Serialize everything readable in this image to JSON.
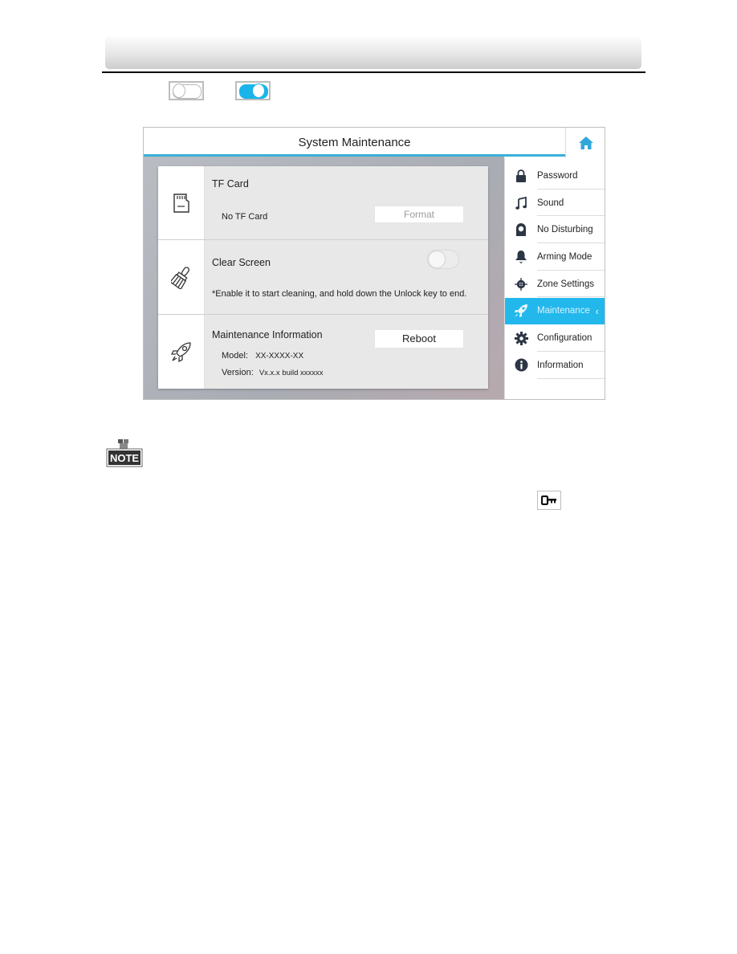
{
  "document": {
    "legend_toggles": [
      {
        "state": "off",
        "icon": "toggle-off-icon"
      },
      {
        "state": "on",
        "icon": "toggle-on-icon"
      }
    ],
    "note_label": "NOTE",
    "key_icon": "key-icon"
  },
  "device": {
    "title": "System Maintenance",
    "home_icon": "home-icon",
    "colors": {
      "accent": "#22b8ec",
      "title_underline": "#3ab0d8"
    },
    "rows": [
      {
        "icon": "tf-card-icon",
        "title": "TF Card",
        "status": "No TF Card",
        "button_label": "Format",
        "button_enabled": false
      },
      {
        "icon": "brush-icon",
        "title": "Clear Screen",
        "toggle_state": "off",
        "hint": "*Enable it to start cleaning, and hold down the Unlock key to end."
      },
      {
        "icon": "rocket-icon",
        "title": "Maintenance Information",
        "button_label": "Reboot",
        "model_label": "Model:",
        "model_value": "XX-XXXX-XX",
        "version_label": "Version:",
        "version_value": "Vx.x.x build xxxxxx"
      }
    ],
    "sidebar": {
      "items": [
        {
          "label": "Password",
          "icon": "lock-icon",
          "active": false
        },
        {
          "label": "Sound",
          "icon": "music-note-icon",
          "active": false
        },
        {
          "label": "No Disturbing",
          "icon": "no-disturb-icon",
          "active": false
        },
        {
          "label": "Arming Mode",
          "icon": "bell-icon",
          "active": false
        },
        {
          "label": "Zone Settings",
          "icon": "target-icon",
          "active": false
        },
        {
          "label": "Maintenance",
          "icon": "rocket-icon",
          "active": true
        },
        {
          "label": "Configuration",
          "icon": "gear-icon",
          "active": false
        },
        {
          "label": "Information",
          "icon": "info-icon",
          "active": false
        }
      ],
      "active_chevron": "‹"
    }
  }
}
